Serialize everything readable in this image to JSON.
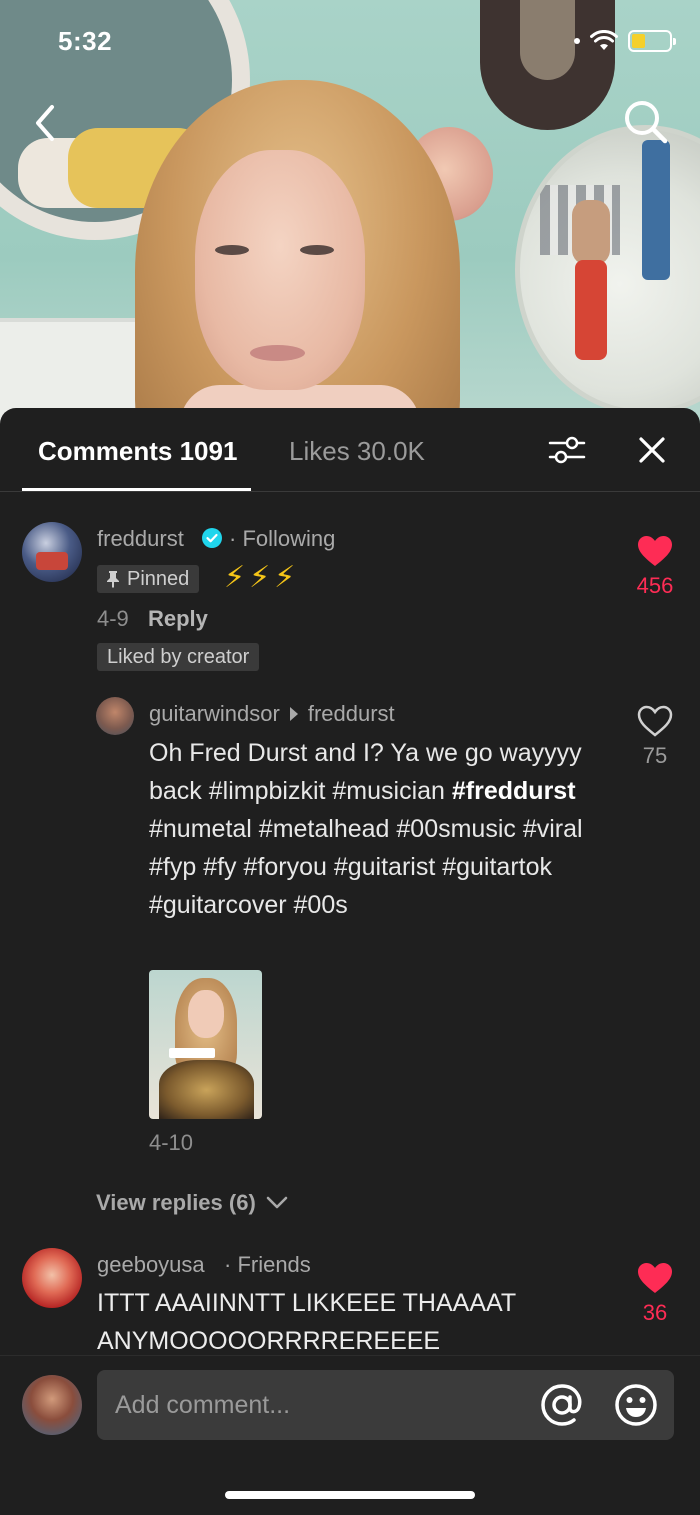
{
  "status_bar": {
    "time": "5:32",
    "battery_level": 0.35,
    "battery_color": "#f5d02b"
  },
  "icons": {
    "back": "chevron-left-icon",
    "search": "search-icon",
    "filter": "sliders-icon",
    "close": "close-icon",
    "verified": "verified-badge-icon",
    "pin": "pin-icon",
    "heart": "heart-icon",
    "mention": "at-sign-icon",
    "emoji": "smiley-icon",
    "chevron_down": "chevron-down-icon"
  },
  "colors": {
    "accent_red": "#fe2c55",
    "sheet_bg": "#1f1f1f",
    "verified_blue": "#20d5ec"
  },
  "tabs": {
    "comments": "Comments 1091",
    "likes": "Likes 30.0K"
  },
  "comments": [
    {
      "username": "freddurst",
      "relationship": "· Following",
      "pinned_label": "Pinned",
      "text": "⚡⚡⚡",
      "date": "4-9",
      "reply_label": "Reply",
      "liked_by_creator": "Liked by creator",
      "likes": "456",
      "liked": true,
      "reply": {
        "username": "guitarwindsor",
        "reply_to": "freddurst",
        "text_before": " Oh Fred Durst and I? Ya we go wayyyy back #limpbizkit #musician ",
        "text_bold": "#freddurst",
        "text_after": " #numetal #metalhead #00smusic #viral #fyp #fy #foryou #guitarist #guitartok #guitarcover #00s",
        "date": "4-10",
        "likes": "75",
        "liked": false
      },
      "view_replies": "View replies (6)"
    },
    {
      "username": "geeboyusa",
      "relationship": "· Friends",
      "text": "ITTT AAAIINNTT LIKKEEE THAAAAT ANYMOOOOORRRREREEEE",
      "likes": "36",
      "liked": true
    }
  ],
  "input": {
    "placeholder": "Add comment..."
  }
}
